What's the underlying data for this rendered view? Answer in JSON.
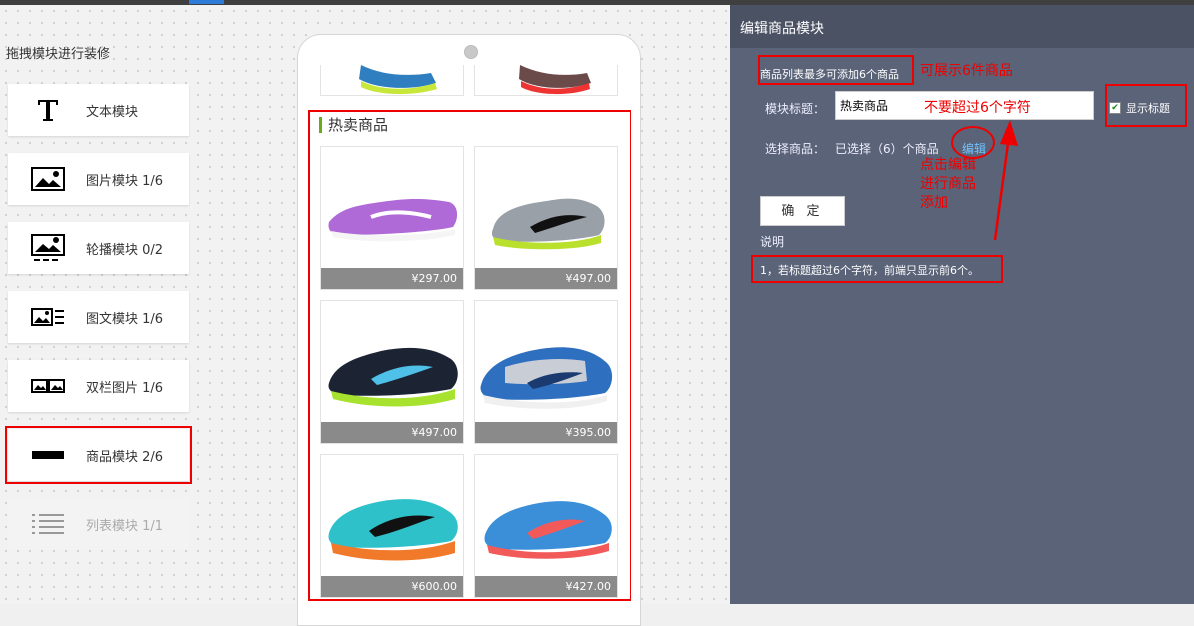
{
  "sidebar": {
    "title": "拖拽模块进行装修",
    "modules": [
      {
        "icon": "text-icon",
        "label": "文本模块"
      },
      {
        "icon": "image-icon",
        "label": "图片模块 1/6"
      },
      {
        "icon": "carousel-icon",
        "label": "轮播模块 0/2"
      },
      {
        "icon": "image-text-icon",
        "label": "图文模块 1/6"
      },
      {
        "icon": "two-column-image-icon",
        "label": "双栏图片 1/6"
      },
      {
        "icon": "product-icon",
        "label": "商品模块 2/6"
      },
      {
        "icon": "list-icon",
        "label": "列表模块 1/1"
      }
    ]
  },
  "preview": {
    "section_title": "热卖商品",
    "products": [
      {
        "price": "¥297.00",
        "color": "#b06ad8"
      },
      {
        "price": "¥497.00",
        "color": "#9aa0a8"
      },
      {
        "price": "¥497.00",
        "color": "#1c2433"
      },
      {
        "price": "¥395.00",
        "color": "#2f6fc0"
      },
      {
        "price": "¥600.00",
        "color": "#2ec1c9"
      },
      {
        "price": "¥427.00",
        "color": "#3a8fd8"
      }
    ]
  },
  "panel": {
    "title": "编辑商品模块",
    "limit_note": "商品列表最多可添加6个商品",
    "module_title_label": "模块标题：",
    "module_title_value": "热卖商品",
    "show_title_label": "显示标题",
    "select_label": "选择商品：",
    "selected_text": "已选择（6）个商品",
    "edit_link": "编辑",
    "confirm_button": "确 定",
    "explain_label": "说明",
    "rule_text": "1，若标题超过6个字符，前端只显示前6个。"
  },
  "annotations": {
    "show_six": "可展示6件商品",
    "max_six_chars": "不要超过6个字符",
    "click_edit": [
      "点击编辑",
      "进行商品",
      "添加"
    ]
  },
  "colors": {
    "highlight": "#e00000",
    "panel_bg": "#5a6378",
    "title_accent": "#6aab1e",
    "link": "#6fc3ff"
  }
}
